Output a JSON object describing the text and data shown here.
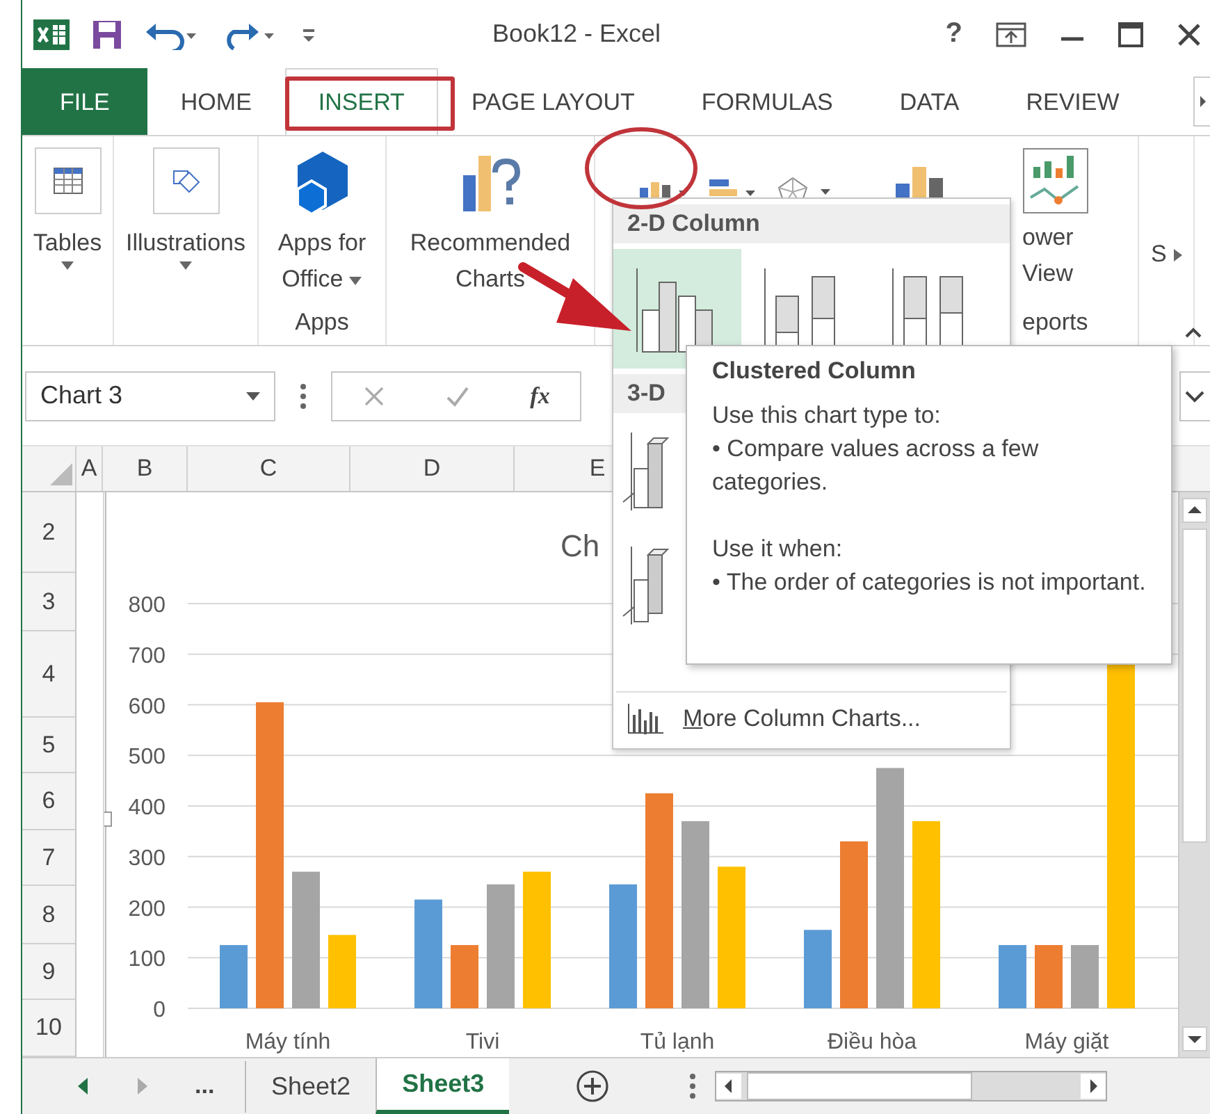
{
  "window": {
    "title": "Book12 - Excel",
    "help": "?"
  },
  "tabs": [
    {
      "label": "FILE",
      "kind": "file",
      "selected": false
    },
    {
      "label": "HOME",
      "kind": "tab",
      "selected": false
    },
    {
      "label": "INSERT",
      "kind": "tab",
      "selected": true
    },
    {
      "label": "PAGE LAYOUT",
      "kind": "tab",
      "selected": false
    },
    {
      "label": "FORMULAS",
      "kind": "tab",
      "selected": false
    },
    {
      "label": "DATA",
      "kind": "tab",
      "selected": false
    },
    {
      "label": "REVIEW",
      "kind": "tab",
      "selected": false
    }
  ],
  "ribbon": {
    "buttons": [
      {
        "kind": "tables",
        "lines": [
          "Tables"
        ],
        "caret": true
      },
      {
        "kind": "illustrations",
        "lines": [
          "Illustrations"
        ],
        "caret": true
      },
      {
        "kind": "apps",
        "lines": [
          "Apps for",
          "Office"
        ],
        "caret": true,
        "group_label": "Apps"
      },
      {
        "kind": "recommended",
        "lines": [
          "Recommended",
          "Charts"
        ]
      },
      {
        "kind": "charts"
      },
      {
        "kind": "powerview",
        "lines": [
          "ower",
          "View"
        ],
        "group_label": "eports"
      },
      {
        "kind": "sparklines",
        "lines": [
          "S"
        ]
      }
    ]
  },
  "formula_bar": {
    "name_box": "Chart 3",
    "fx": "fx"
  },
  "columns": [
    "A",
    "B",
    "C",
    "D",
    "E"
  ],
  "rows": [
    "2",
    "3",
    "4",
    "5",
    "6",
    "7",
    "8",
    "9",
    "10"
  ],
  "chart_data": {
    "type": "bar",
    "title": "Ch",
    "categories": [
      "Máy tính",
      "Tivi",
      "Tủ lạnh",
      "Điều hòa",
      "Máy giặt"
    ],
    "series": [
      {
        "color": "#5b9bd5",
        "values": [
          125,
          215,
          245,
          155,
          125
        ]
      },
      {
        "color": "#ed7d31",
        "values": [
          605,
          125,
          425,
          330,
          125
        ]
      },
      {
        "color": "#a5a5a5",
        "values": [
          270,
          245,
          370,
          475,
          125
        ]
      },
      {
        "color": "#ffc000",
        "values": [
          145,
          270,
          280,
          370,
          680
        ]
      }
    ],
    "grid": true,
    "ylim": [
      0,
      800
    ],
    "yticks": [
      0,
      100,
      200,
      300,
      400,
      500,
      600,
      700,
      800
    ]
  },
  "dropdown": {
    "sections": [
      {
        "title": "2-D Column",
        "items": [
          {
            "kind": "clustered",
            "selected": true
          },
          {
            "kind": "stacked",
            "selected": false
          },
          {
            "kind": "stacked100",
            "selected": false
          }
        ]
      },
      {
        "title": "3-D",
        "items": [
          {
            "kind": "clustered3d",
            "selected": false
          },
          {
            "kind": "stacked3d",
            "selected": false
          }
        ]
      }
    ],
    "footer": "More Column Charts..."
  },
  "tooltip": {
    "title": "Clustered Column",
    "blocks": [
      {
        "heading": "Use this chart type to:",
        "bullet": "• Compare values across a few categories."
      },
      {
        "heading": "Use it when:",
        "bullet": "• The order of categories is not important."
      }
    ]
  },
  "sheet_tabs": {
    "more": "...",
    "sheets": [
      {
        "label": "Sheet2",
        "selected": false
      },
      {
        "label": "Sheet3",
        "selected": true
      }
    ]
  }
}
